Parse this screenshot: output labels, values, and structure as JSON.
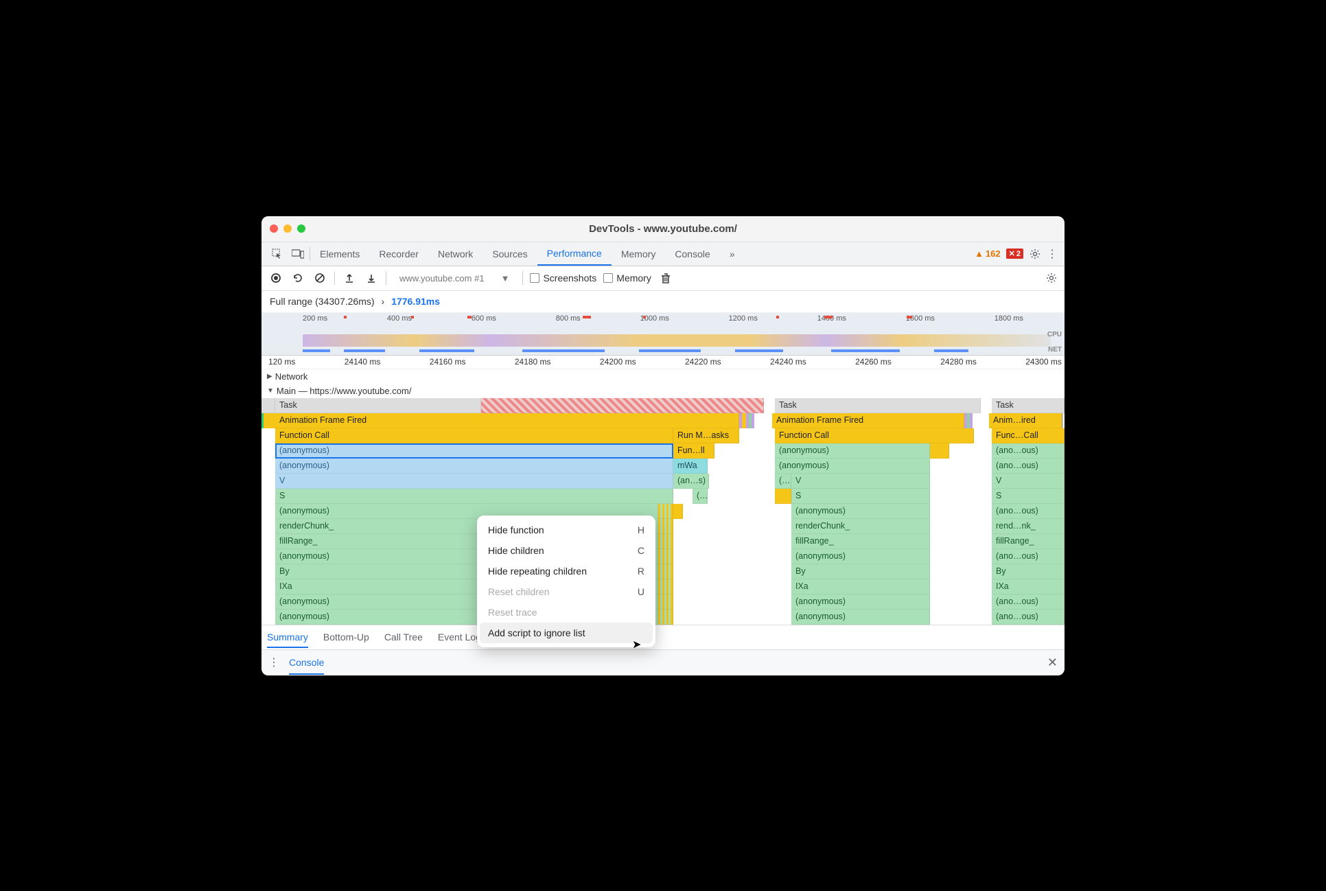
{
  "window": {
    "title": "DevTools - www.youtube.com/"
  },
  "tabs": [
    "Elements",
    "Recorder",
    "Network",
    "Sources",
    "Performance",
    "Memory",
    "Console"
  ],
  "active_tab": "Performance",
  "warnings_count": "162",
  "errors_count": "2",
  "toolbar": {
    "profile": "www.youtube.com #1",
    "screenshots_label": "Screenshots",
    "memory_label": "Memory"
  },
  "breadcrumb": {
    "full_range": "Full range (34307.26ms)",
    "current": "1776.91ms"
  },
  "overview_ticks": [
    "200 ms",
    "400 ms",
    "600 ms",
    "800 ms",
    "1000 ms",
    "1200 ms",
    "1400 ms",
    "1600 ms",
    "1800 ms"
  ],
  "overview_labels": {
    "cpu": "CPU",
    "net": "NET"
  },
  "ruler2": [
    "120 ms",
    "24140 ms",
    "24160 ms",
    "24180 ms",
    "24200 ms",
    "24220 ms",
    "24240 ms",
    "24260 ms",
    "24280 ms",
    "24300 ms"
  ],
  "tracks": {
    "network": "Network",
    "main": "Main — https://www.youtube.com/"
  },
  "flame": {
    "col1": {
      "task": "Task",
      "aff": "Animation Frame Fired",
      "fn": "Function Call",
      "anon1": "(anonymous)",
      "anon2": "(anonymous)",
      "v": "V",
      "s": "S",
      "anon3": "(anonymous)",
      "renderChunk": "renderChunk_",
      "fillRange": "fillRange_",
      "anon4": "(anonymous)",
      "by": "By",
      "ixa": "IXa",
      "anon5": "(anonymous)",
      "anon6": "(anonymous)"
    },
    "mid": {
      "run": "Run M…asks",
      "fun": "Fun…ll",
      "mwa": "mWa",
      "ans": "(an…s)",
      "paren": "(…"
    },
    "col2": {
      "task": "Task",
      "aff": "Animation Frame Fired",
      "fn": "Function Call",
      "anon1": "(anonymous)",
      "anon2": "(anonymous)",
      "paren": "(…",
      "v": "V",
      "s": "S",
      "anon3": "(anonymous)",
      "renderChunk": "renderChunk_",
      "fillRange": "fillRange_",
      "anon4": "(anonymous)",
      "by": "By",
      "ixa": "IXa",
      "anon5": "(anonymous)",
      "anon6": "(anonymous)"
    },
    "col3": {
      "task": "Task",
      "aff": "Anim…ired",
      "fn": "Func…Call",
      "anon1": "(ano…ous)",
      "anon2": "(ano…ous)",
      "v": "V",
      "s": "S",
      "anon3": "(ano…ous)",
      "renderChunk": "rend…nk_",
      "fillRange": "fillRange_",
      "anon4": "(ano…ous)",
      "by": "By",
      "ixa": "IXa",
      "anon5": "(ano…ous)",
      "anon6": "(ano…ous)"
    }
  },
  "context_menu": [
    {
      "label": "Hide function",
      "key": "H",
      "enabled": true
    },
    {
      "label": "Hide children",
      "key": "C",
      "enabled": true
    },
    {
      "label": "Hide repeating children",
      "key": "R",
      "enabled": true
    },
    {
      "label": "Reset children",
      "key": "U",
      "enabled": false
    },
    {
      "label": "Reset trace",
      "key": "",
      "enabled": false
    },
    {
      "label": "Add script to ignore list",
      "key": "",
      "enabled": true,
      "hover": true
    }
  ],
  "bottom_tabs": [
    "Summary",
    "Bottom-Up",
    "Call Tree",
    "Event Log"
  ],
  "bottom_active": "Summary",
  "console_drawer": "Console"
}
